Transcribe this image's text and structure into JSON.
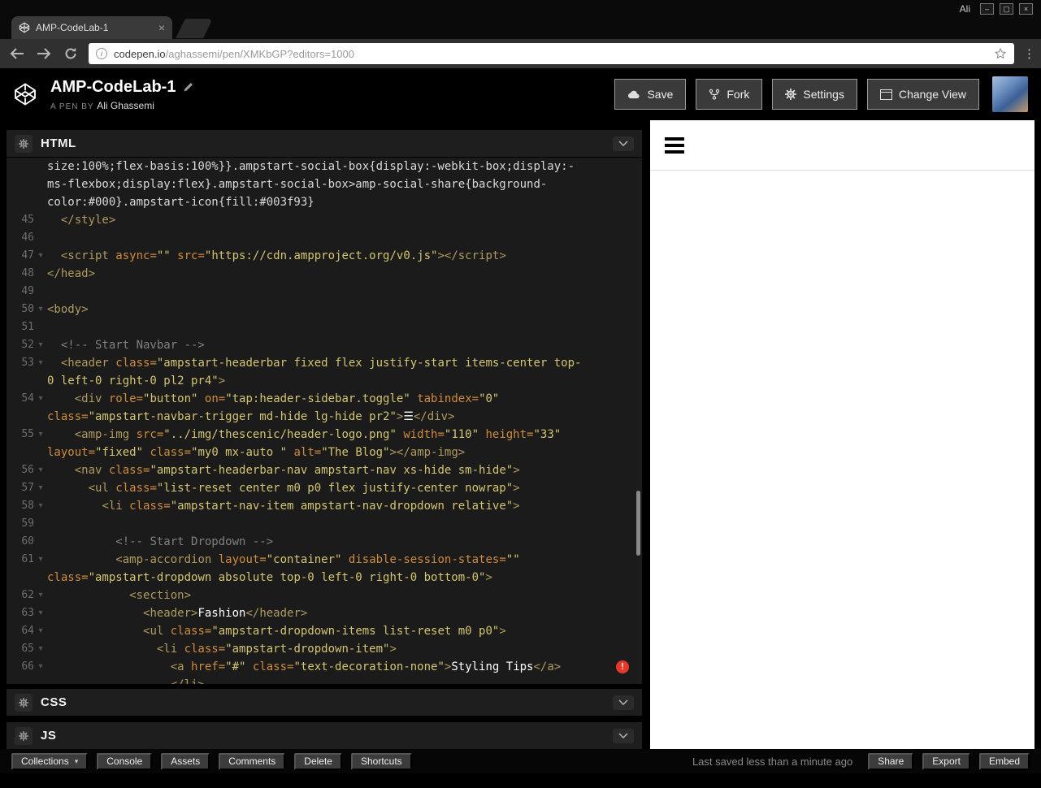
{
  "window": {
    "profile_label": "Ali",
    "tab_title": "AMP-CodeLab-1",
    "url_host": "codepen.io",
    "url_path": "/aghassemi/pen/XMKbGP?editors=1000"
  },
  "pen": {
    "title": "AMP-CodeLab-1",
    "byline_prefix": "A PEN BY",
    "author": "Ali Ghassemi"
  },
  "actions": {
    "save": "Save",
    "fork": "Fork",
    "settings": "Settings",
    "change_view": "Change View"
  },
  "panels": {
    "html": "HTML",
    "css": "CSS",
    "js": "JS"
  },
  "footer": {
    "collections": "Collections",
    "console": "Console",
    "assets": "Assets",
    "comments": "Comments",
    "delete": "Delete",
    "shortcuts": "Shortcuts",
    "status": "Last saved less than a minute ago",
    "share": "Share",
    "export": "Export",
    "embed": "Embed"
  },
  "colors": {
    "plain": "#d9d9d9",
    "tag": "#b09a5e",
    "attr": "#cf8b3e",
    "string": "#d3c571",
    "comment": "#808080",
    "text": "#ffffff",
    "error": "#e8372c",
    "editor_bg": "#1b1b1b"
  },
  "code": {
    "rows": [
      {
        "n": "",
        "seg": [
          [
            "p",
            "size:100%;flex-basis:100%}}.ampstart-social-box{display:-webkit-box;display:-"
          ]
        ]
      },
      {
        "n": "",
        "seg": [
          [
            "p",
            "ms-flexbox;display:flex}.ampstart-social-box>amp-social-share{background-"
          ]
        ]
      },
      {
        "n": "",
        "seg": [
          [
            "p",
            "color:#000}.ampstart-icon{fill:#003f93}"
          ]
        ]
      },
      {
        "n": "45",
        "seg": [
          [
            "p",
            "  "
          ],
          [
            "t",
            "</style>"
          ]
        ]
      },
      {
        "n": "46",
        "seg": []
      },
      {
        "n": "47",
        "fold": true,
        "seg": [
          [
            "p",
            "  "
          ],
          [
            "t",
            "<script "
          ],
          [
            "a",
            "async="
          ],
          [
            "s",
            "\"\" "
          ],
          [
            "a",
            "src="
          ],
          [
            "s",
            "\"https://cdn.ampproject.org/v0.js\""
          ],
          [
            "t",
            "></script>"
          ]
        ]
      },
      {
        "n": "48",
        "seg": [
          [
            "t",
            "</head>"
          ]
        ]
      },
      {
        "n": "49",
        "seg": []
      },
      {
        "n": "50",
        "fold": true,
        "seg": [
          [
            "t",
            "<body>"
          ]
        ]
      },
      {
        "n": "51",
        "seg": []
      },
      {
        "n": "52",
        "fold": true,
        "seg": [
          [
            "p",
            "  "
          ],
          [
            "c",
            "<!-- Start Navbar -->"
          ]
        ]
      },
      {
        "n": "53",
        "fold": true,
        "seg": [
          [
            "p",
            "  "
          ],
          [
            "t",
            "<header "
          ],
          [
            "a",
            "class="
          ],
          [
            "s",
            "\"ampstart-headerbar fixed flex justify-start items-center top-"
          ]
        ]
      },
      {
        "n": "",
        "seg": [
          [
            "s",
            "0 left-0 right-0 pl2 pr4\""
          ],
          [
            "t",
            ">"
          ]
        ]
      },
      {
        "n": "54",
        "fold": true,
        "seg": [
          [
            "p",
            "    "
          ],
          [
            "t",
            "<div "
          ],
          [
            "a",
            "role="
          ],
          [
            "s",
            "\"button\" "
          ],
          [
            "a",
            "on="
          ],
          [
            "s",
            "\"tap:header-sidebar.toggle\" "
          ],
          [
            "a",
            "tabindex="
          ],
          [
            "s",
            "\"0\""
          ]
        ]
      },
      {
        "n": "",
        "seg": [
          [
            "a",
            "class="
          ],
          [
            "s",
            "\"ampstart-navbar-trigger md-hide lg-hide pr2\""
          ],
          [
            "t",
            ">"
          ],
          [
            "x",
            "☰"
          ],
          [
            "t",
            "</div>"
          ]
        ]
      },
      {
        "n": "55",
        "fold": true,
        "seg": [
          [
            "p",
            "    "
          ],
          [
            "t",
            "<amp-img "
          ],
          [
            "a",
            "src="
          ],
          [
            "s",
            "\"../img/thescenic/header-logo.png\" "
          ],
          [
            "a",
            "width="
          ],
          [
            "s",
            "\"110\" "
          ],
          [
            "a",
            "height="
          ],
          [
            "s",
            "\"33\""
          ]
        ]
      },
      {
        "n": "",
        "seg": [
          [
            "a",
            "layout="
          ],
          [
            "s",
            "\"fixed\" "
          ],
          [
            "a",
            "class="
          ],
          [
            "s",
            "\"my0 mx-auto \" "
          ],
          [
            "a",
            "alt="
          ],
          [
            "s",
            "\"The Blog\""
          ],
          [
            "t",
            "></amp-img>"
          ]
        ]
      },
      {
        "n": "56",
        "fold": true,
        "seg": [
          [
            "p",
            "    "
          ],
          [
            "t",
            "<nav "
          ],
          [
            "a",
            "class="
          ],
          [
            "s",
            "\"ampstart-headerbar-nav ampstart-nav xs-hide sm-hide\""
          ],
          [
            "t",
            ">"
          ]
        ]
      },
      {
        "n": "57",
        "fold": true,
        "seg": [
          [
            "p",
            "      "
          ],
          [
            "t",
            "<ul "
          ],
          [
            "a",
            "class="
          ],
          [
            "s",
            "\"list-reset center m0 p0 flex justify-center nowrap\""
          ],
          [
            "t",
            ">"
          ]
        ]
      },
      {
        "n": "58",
        "fold": true,
        "seg": [
          [
            "p",
            "        "
          ],
          [
            "t",
            "<li "
          ],
          [
            "a",
            "class="
          ],
          [
            "s",
            "\"ampstart-nav-item ampstart-nav-dropdown relative\""
          ],
          [
            "t",
            ">"
          ]
        ]
      },
      {
        "n": "59",
        "seg": []
      },
      {
        "n": "60",
        "seg": [
          [
            "p",
            "          "
          ],
          [
            "c",
            "<!-- Start Dropdown -->"
          ]
        ]
      },
      {
        "n": "61",
        "fold": true,
        "seg": [
          [
            "p",
            "          "
          ],
          [
            "t",
            "<amp-accordion "
          ],
          [
            "a",
            "layout="
          ],
          [
            "s",
            "\"container\" "
          ],
          [
            "a",
            "disable-session-states="
          ],
          [
            "s",
            "\"\""
          ]
        ]
      },
      {
        "n": "",
        "seg": [
          [
            "a",
            "class="
          ],
          [
            "s",
            "\"ampstart-dropdown absolute top-0 left-0 right-0 bottom-0\""
          ],
          [
            "t",
            ">"
          ]
        ]
      },
      {
        "n": "62",
        "fold": true,
        "seg": [
          [
            "p",
            "            "
          ],
          [
            "t",
            "<section>"
          ]
        ]
      },
      {
        "n": "63",
        "fold": true,
        "seg": [
          [
            "p",
            "              "
          ],
          [
            "t",
            "<header>"
          ],
          [
            "x",
            "Fashion"
          ],
          [
            "t",
            "</header>"
          ]
        ]
      },
      {
        "n": "64",
        "fold": true,
        "seg": [
          [
            "p",
            "              "
          ],
          [
            "t",
            "<ul "
          ],
          [
            "a",
            "class="
          ],
          [
            "s",
            "\"ampstart-dropdown-items list-reset m0 p0\""
          ],
          [
            "t",
            ">"
          ]
        ]
      },
      {
        "n": "65",
        "fold": true,
        "seg": [
          [
            "p",
            "                "
          ],
          [
            "t",
            "<li "
          ],
          [
            "a",
            "class="
          ],
          [
            "s",
            "\"ampstart-dropdown-item\""
          ],
          [
            "t",
            ">"
          ]
        ]
      },
      {
        "n": "66",
        "fold": true,
        "error": true,
        "seg": [
          [
            "p",
            "                  "
          ],
          [
            "t",
            "<a "
          ],
          [
            "a",
            "href="
          ],
          [
            "s",
            "\"#\" "
          ],
          [
            "a",
            "class="
          ],
          [
            "s",
            "\"text-decoration-none\""
          ],
          [
            "t",
            ">"
          ],
          [
            "x",
            "Styling Tips"
          ],
          [
            "t",
            "</a>"
          ]
        ]
      },
      {
        "n": "",
        "seg": [
          [
            "p",
            "                  "
          ],
          [
            "t",
            "</li>"
          ]
        ]
      }
    ]
  }
}
